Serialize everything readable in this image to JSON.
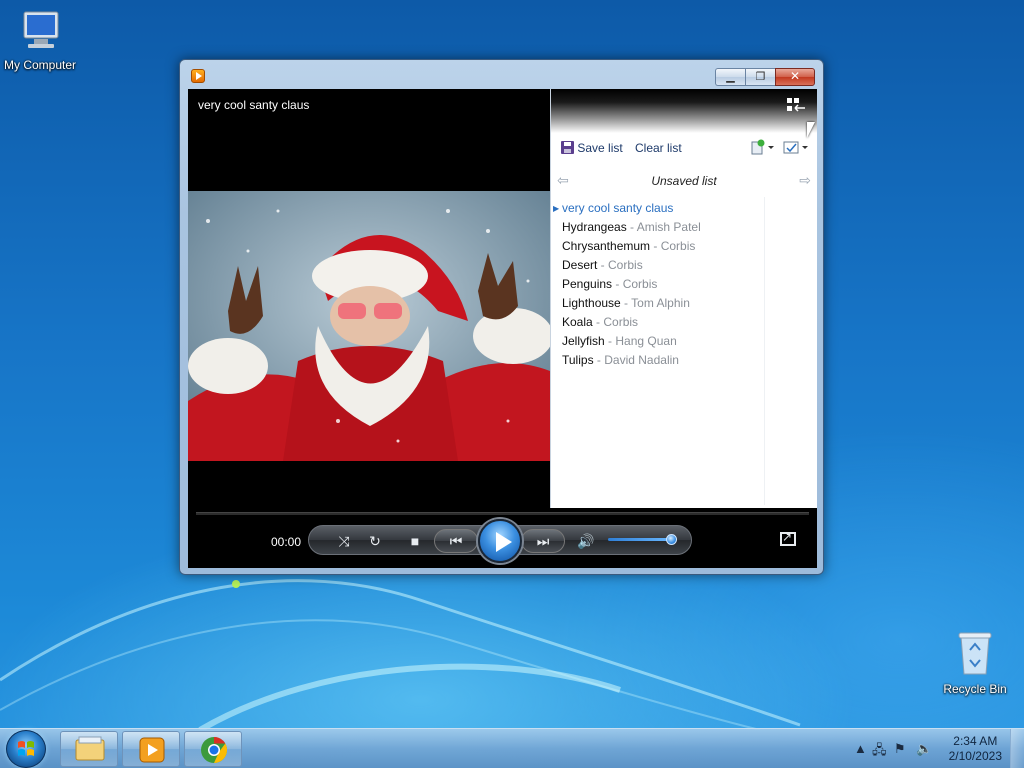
{
  "desktop": {
    "icons": [
      {
        "label": "My Computer",
        "icon": "computer-icon"
      },
      {
        "label": "Recycle Bin",
        "icon": "recycle-bin-icon"
      }
    ]
  },
  "player": {
    "now_playing_title": "very cool santy claus",
    "toolbar": {
      "save_list_label": "Save list",
      "clear_list_label": "Clear list"
    },
    "list_title": "Unsaved list",
    "playlist": [
      {
        "title": "very cool santy claus",
        "artist": "",
        "current": true
      },
      {
        "title": "Hydrangeas",
        "artist": "Amish Patel",
        "current": false
      },
      {
        "title": "Chrysanthemum",
        "artist": "Corbis",
        "current": false
      },
      {
        "title": "Desert",
        "artist": "Corbis",
        "current": false
      },
      {
        "title": "Penguins",
        "artist": "Corbis",
        "current": false
      },
      {
        "title": "Lighthouse",
        "artist": "Tom Alphin",
        "current": false
      },
      {
        "title": "Koala",
        "artist": "Corbis",
        "current": false
      },
      {
        "title": "Jellyfish",
        "artist": "Hang Quan",
        "current": false
      },
      {
        "title": "Tulips",
        "artist": "David Nadalin",
        "current": false
      }
    ],
    "controls": {
      "elapsed_time": "00:00",
      "volume_level": 0.9
    }
  },
  "taskbar": {
    "clock_time": "2:34 AM",
    "clock_date": "2/10/2023",
    "pinned": [
      "windows-explorer-icon",
      "media-player-icon",
      "chrome-icon"
    ]
  },
  "colors": {
    "desktop_blue": "#1a78c8",
    "playlist_current": "#2a6fc0",
    "artist_gray": "#8a8f96"
  }
}
